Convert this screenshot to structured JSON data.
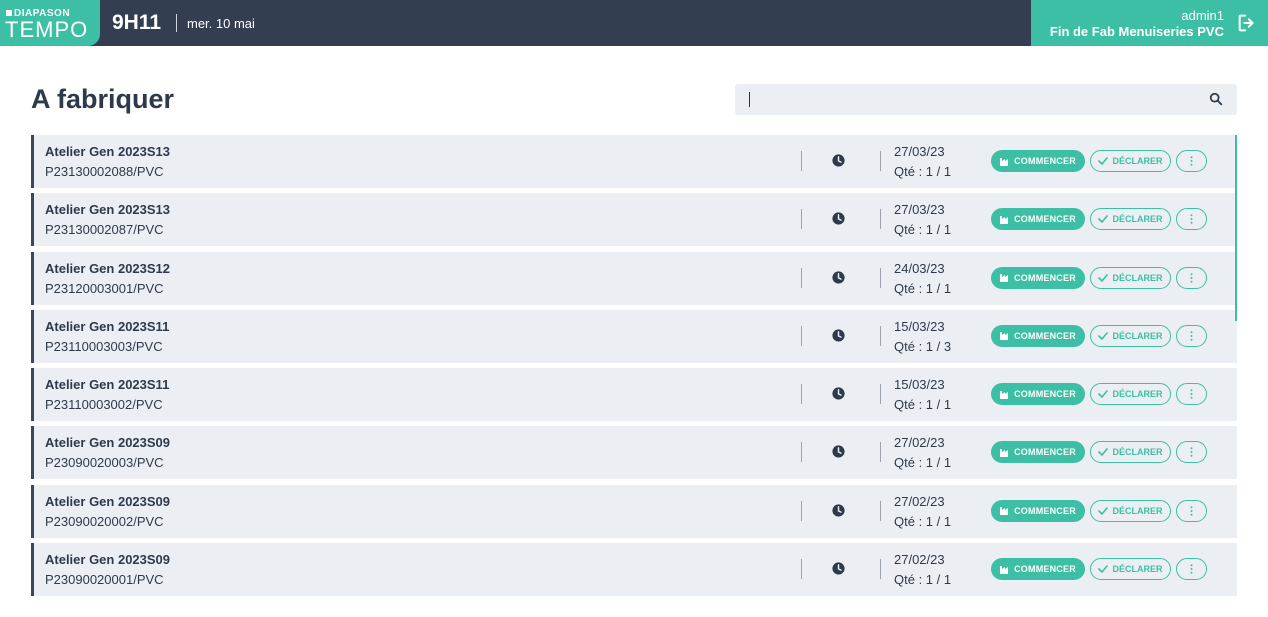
{
  "header": {
    "logo_top": "DIAPASON",
    "logo_main": "TEMPO",
    "time": "9H11",
    "date": "mer. 10 mai",
    "user": "admin1",
    "poste": "Fin de Fab Menuiseries PVC"
  },
  "page": {
    "title": "A fabriquer",
    "search_placeholder": ""
  },
  "labels": {
    "start": "COMMENCER",
    "declare": "DÉCLARER"
  },
  "rows": [
    {
      "atelier": "Atelier Gen 2023S13",
      "ref": "P23130002088/PVC",
      "date": "27/03/23",
      "qte": "Qté : 1 / 1"
    },
    {
      "atelier": "Atelier Gen 2023S13",
      "ref": "P23130002087/PVC",
      "date": "27/03/23",
      "qte": "Qté : 1 / 1"
    },
    {
      "atelier": "Atelier Gen 2023S12",
      "ref": "P23120003001/PVC",
      "date": "24/03/23",
      "qte": "Qté : 1 / 1"
    },
    {
      "atelier": "Atelier Gen 2023S11",
      "ref": "P23110003003/PVC",
      "date": "15/03/23",
      "qte": "Qté : 1 / 3"
    },
    {
      "atelier": "Atelier Gen 2023S11",
      "ref": "P23110003002/PVC",
      "date": "15/03/23",
      "qte": "Qté : 1 / 1"
    },
    {
      "atelier": "Atelier Gen 2023S09",
      "ref": "P23090020003/PVC",
      "date": "27/02/23",
      "qte": "Qté : 1 / 1"
    },
    {
      "atelier": "Atelier Gen 2023S09",
      "ref": "P23090020002/PVC",
      "date": "27/02/23",
      "qte": "Qté : 1 / 1"
    },
    {
      "atelier": "Atelier Gen 2023S09",
      "ref": "P23090020001/PVC",
      "date": "27/02/23",
      "qte": "Qté : 1 / 1"
    }
  ],
  "colors": {
    "accent": "#3cbfa4",
    "header_bg": "#333f50",
    "row_bg": "#ebeff3"
  },
  "icons": {
    "search": "search-icon",
    "clock": "clock-icon",
    "logout": "logout-icon",
    "factory": "factory-icon",
    "check": "check-icon",
    "more": "more-vertical-icon"
  }
}
